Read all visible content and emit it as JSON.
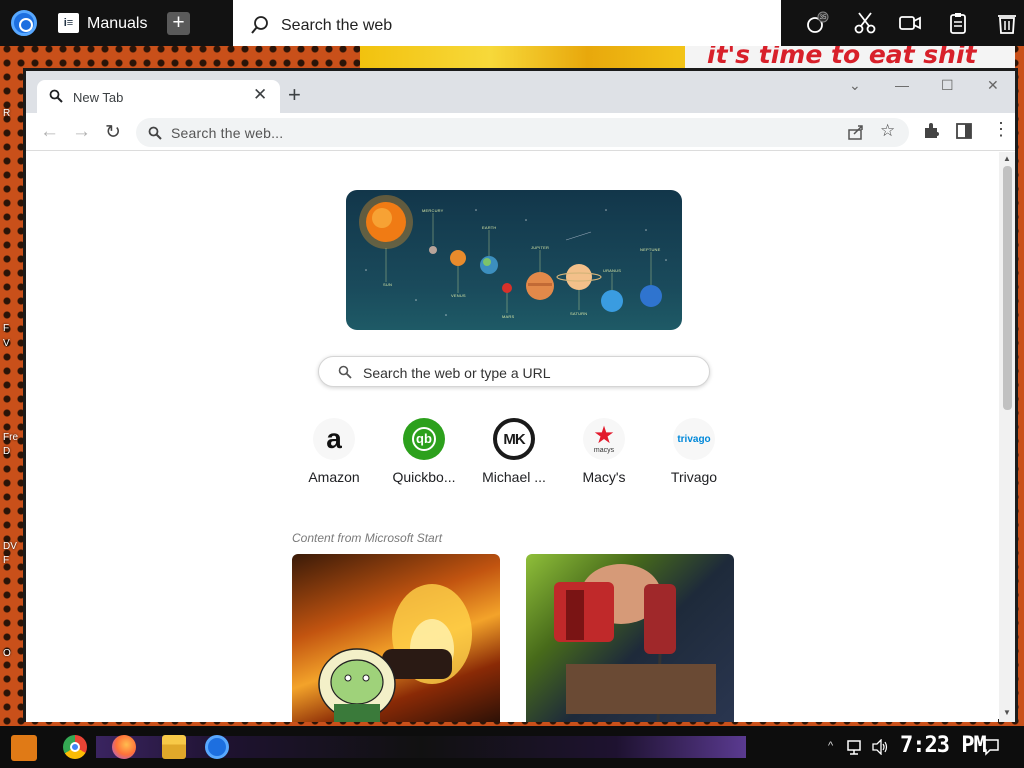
{
  "desktop": {
    "banner_text": "it's time to eat shit",
    "labels": [
      "R",
      "F",
      "V",
      "Fre",
      "D",
      "DV",
      "F",
      "O"
    ]
  },
  "topbar": {
    "app_name": "Manuals",
    "search_placeholder": "Search the web",
    "badge": "35"
  },
  "browser": {
    "tab_title": "New Tab",
    "omnibox_text": "Search the web..."
  },
  "page": {
    "search_placeholder": "Search the web or type a URL",
    "planets": [
      "MERCURY",
      "EARTH",
      "JUPITER",
      "URANUS",
      "NEPTUNE",
      "SUN",
      "VENUS",
      "MARS",
      "SATURN"
    ],
    "quick_links": [
      {
        "label": "Amazon",
        "icon": "amazon-logo"
      },
      {
        "label": "Quickbo...",
        "icon": "quickbooks-logo"
      },
      {
        "label": "Michael ...",
        "icon": "michael-kors-logo"
      },
      {
        "label": "Macy's",
        "icon": "macys-logo"
      },
      {
        "label": "Trivago",
        "icon": "trivago-logo"
      }
    ],
    "content_from": "Content from Microsoft Start",
    "tile_texts": {
      "amazon": "a",
      "quickbooks": "qb",
      "mk": "MK",
      "macys": "macys",
      "trivago": "trivago"
    }
  },
  "taskbar": {
    "time": "7:23 PM"
  },
  "colors": {
    "accent": "#1d6fe0",
    "quickbooks": "#2ca01c",
    "macys": "#e21a2c",
    "trivago": "#0088d9"
  }
}
